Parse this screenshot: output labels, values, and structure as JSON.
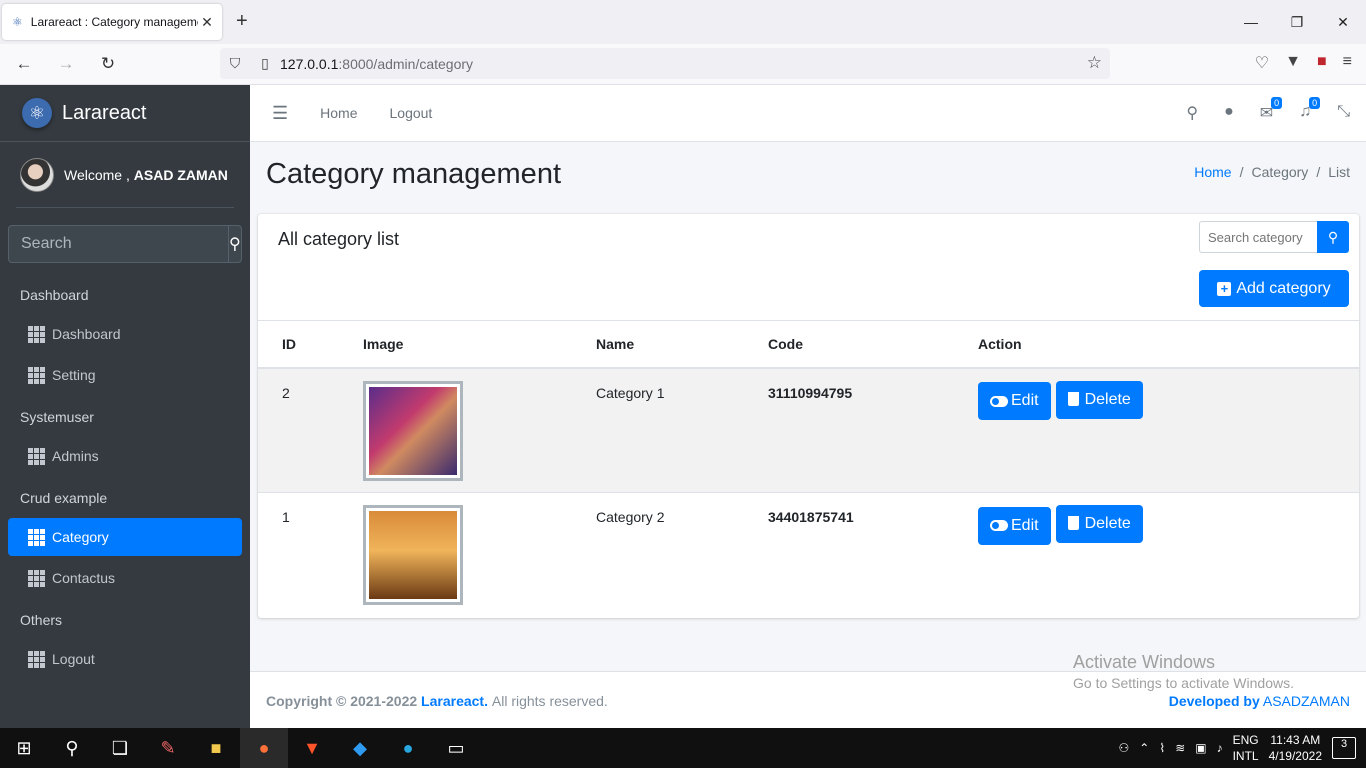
{
  "browser": {
    "tab_title": "Larareact : Category manageme",
    "url_host": "127.0.0.1",
    "url_rest": ":8000/admin/category"
  },
  "sidebar": {
    "brand": "Larareact",
    "welcome_prefix": "Welcome ,",
    "user_name": "ASAD ZAMAN",
    "search_placeholder": "Search",
    "sections": [
      {
        "header": "Dashboard",
        "items": [
          "Dashboard",
          "Setting"
        ]
      },
      {
        "header": "Systemuser",
        "items": [
          "Admins"
        ]
      },
      {
        "header": "Crud example",
        "items": [
          "Category",
          "Contactus"
        ]
      },
      {
        "header": "Others",
        "items": [
          "Logout"
        ]
      }
    ],
    "active_item": "Category"
  },
  "topnav": {
    "links": [
      "Home",
      "Logout"
    ],
    "messages_count": "0",
    "notifications_count": "0"
  },
  "page": {
    "title": "Category management",
    "breadcrumb": [
      "Home",
      "Category",
      "List"
    ]
  },
  "card": {
    "title": "All category list",
    "search_placeholder": "Search category",
    "add_button": "Add category",
    "columns": [
      "ID",
      "Image",
      "Name",
      "Code",
      "Action"
    ],
    "rows": [
      {
        "id": "2",
        "name": "Category 1",
        "code": "31110994795",
        "edit": "Edit",
        "delete": "Delete"
      },
      {
        "id": "1",
        "name": "Category 2",
        "code": "34401875741",
        "edit": "Edit",
        "delete": "Delete"
      }
    ]
  },
  "footer": {
    "copyright": "Copyright © 2021-2022",
    "brand": "Larareact.",
    "rights": "All rights reserved.",
    "developed_by": "Developed by",
    "developer": "ASADZAMAN"
  },
  "watermark": {
    "line1": "Activate Windows",
    "line2": "Go to Settings to activate Windows."
  },
  "taskbar": {
    "lang1": "ENG",
    "lang2": "INTL",
    "time": "11:43 AM",
    "date": "4/19/2022",
    "notifications": "3"
  }
}
